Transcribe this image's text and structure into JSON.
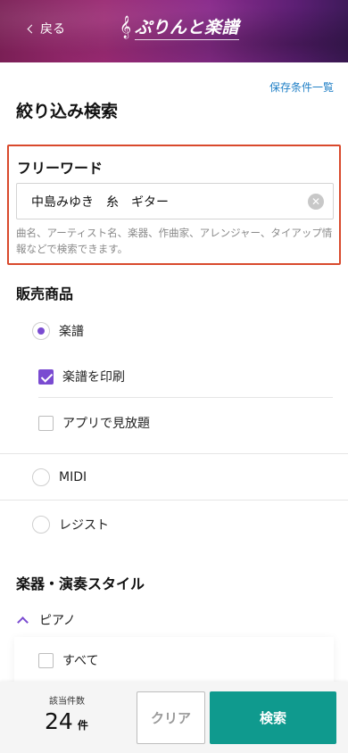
{
  "header": {
    "back_label": "戻る",
    "logo_text": "ぷりんと楽譜"
  },
  "saved_conditions_link": "保存条件一覧",
  "page_title": "絞り込み検索",
  "freeword": {
    "title": "フリーワード",
    "value": "中島みゆき　糸　ギター",
    "help": "曲名、アーティスト名、楽器、作曲家、アレンジャー、タイアップ情報などで検索できます。"
  },
  "sales": {
    "title": "販売商品",
    "options": [
      {
        "label": "楽譜",
        "type": "radio",
        "selected": true
      },
      {
        "label": "楽譜を印刷",
        "type": "checkbox",
        "checked": true
      },
      {
        "label": "アプリで見放題",
        "type": "checkbox",
        "checked": false
      },
      {
        "label": "MIDI",
        "type": "radio",
        "selected": false
      },
      {
        "label": "レジスト",
        "type": "radio",
        "selected": false
      }
    ]
  },
  "instruments": {
    "title": "楽器・演奏スタイル",
    "group_label": "ピアノ",
    "all_label": "すべて"
  },
  "footer": {
    "count_label": "該当件数",
    "count": "24",
    "count_unit": "件",
    "clear_label": "クリア",
    "search_label": "検索"
  },
  "colors": {
    "accent_purple": "#7a4bd1",
    "search_green": "#0f9a8e",
    "highlight_red": "#d9492c",
    "link_blue": "#1f7fc6"
  }
}
